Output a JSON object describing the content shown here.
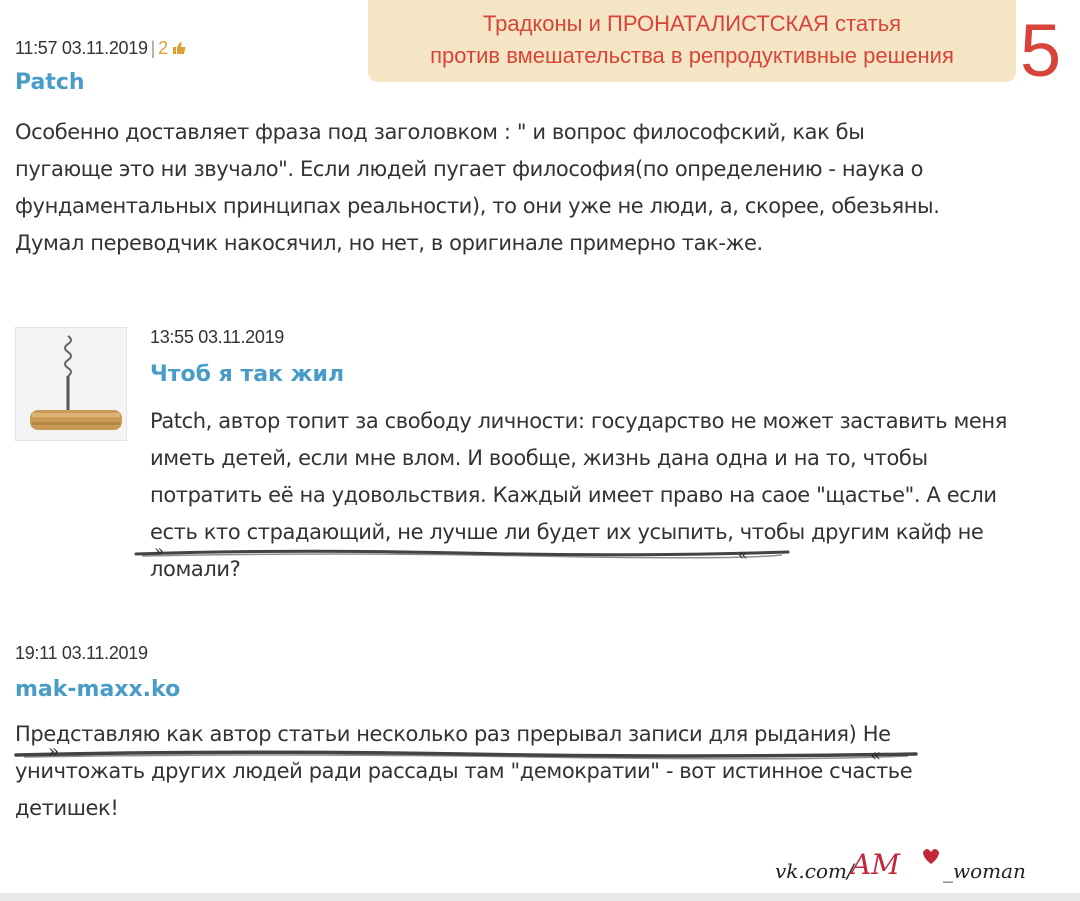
{
  "banner": {
    "line1": "Традконы и ПРОНАТАЛИСТСКАЯ статья",
    "line2": "против вмешательства в репродуктивные решения",
    "number": "5"
  },
  "comments": [
    {
      "time": "11:57 03.11.2019",
      "likes": "2",
      "author": "Patch",
      "lines": [
        "Особенно доставляет фраза под заголовком : \" и вопрос философский, как бы",
        "пугающе это ни звучало\". Если людей пугает философия(по определению - наука о",
        "фундаментальных принципах реальности), то они уже не люди, а, скорее, обезьяны.",
        "Думал переводчик накосячил, но нет, в оригинале примерно так-же."
      ]
    },
    {
      "time": "13:55 03.11.2019",
      "author": "Чтоб я так жил",
      "lines": [
        "Patch, автор топит за свободу личности: государство не может заставить меня",
        "иметь детей, если мне влом. И вообще, жизнь дана одна и на то, чтобы",
        "потратить её на удовольствия. Каждый имеет право на саое \"щастье\". А если",
        "есть кто страдающий, не лучше ли будет их усыпить, чтобы другим кайф не",
        "ломали?"
      ]
    },
    {
      "time": "19:11 03.11.2019",
      "author": "mak-maxx.ko",
      "lines": [
        "Представляю как автор статьи несколько раз прерывал записи для рыдания) Не",
        "уничтожать других людей ради рассады там \"демократии\" - вот истинное счастье",
        "детишек!"
      ]
    }
  ],
  "watermark": "vk.com/AM_woman",
  "colors": {
    "banner_bg": "#f4e6c4",
    "banner_text": "#d8433a",
    "author_link": "#4a9cc8"
  }
}
